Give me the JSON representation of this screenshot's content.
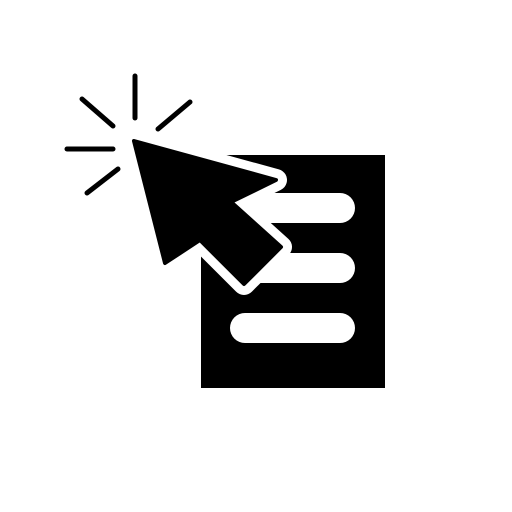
{
  "icon": {
    "name": "document-click-icon",
    "colors": {
      "background": "#ffffff",
      "foreground": "#000000"
    },
    "document_line_count": 3
  }
}
